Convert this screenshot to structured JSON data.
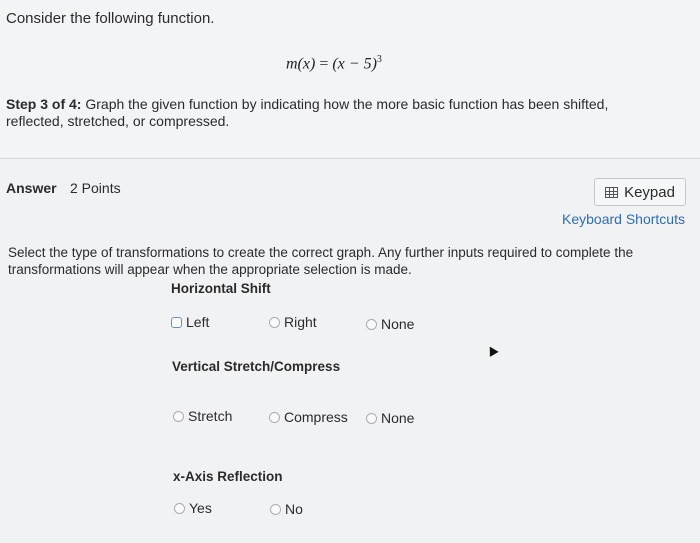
{
  "question": {
    "intro": "Consider the following function.",
    "formula": {
      "lhs": "m(x)",
      "eq": " = ",
      "rhs": "(x − 5)",
      "exp": "3"
    },
    "step_bold": "Step 3 of 4:",
    "step_text": " Graph the given function by indicating how the more basic function has been shifted, reflected, stretched, or compressed."
  },
  "answer": {
    "label": "Answer",
    "points": "2 Points",
    "keypad_label": "Keypad",
    "shortcuts_label": "Keyboard Shortcuts",
    "instructions": "Select the type of transformations to create the correct graph. Any further inputs required to complete the transformations will appear when the appropriate selection is made."
  },
  "horizontal_shift": {
    "title": "Horizontal Shift",
    "options": [
      "Left",
      "Right",
      "None"
    ]
  },
  "vertical_stretch": {
    "title": "Vertical Stretch/Compress",
    "options": [
      "Stretch",
      "Compress",
      "None"
    ]
  },
  "x_axis_reflection": {
    "title": "x-Axis Reflection",
    "options": [
      "Yes",
      "No"
    ]
  }
}
